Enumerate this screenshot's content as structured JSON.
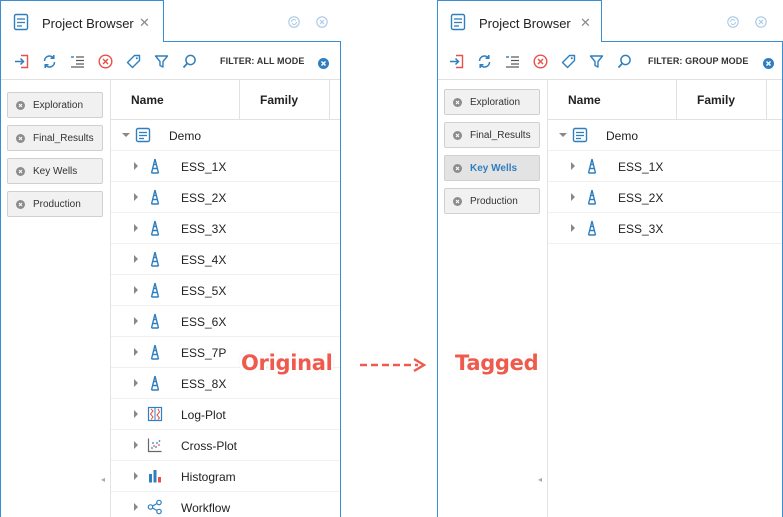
{
  "left_panel": {
    "tab_title": "Project Browser",
    "filter_label": "FILTER: ALL MODE",
    "tags": [
      {
        "label": "Exploration",
        "active": false
      },
      {
        "label": "Final_Results",
        "active": false
      },
      {
        "label": "Key Wells",
        "active": false
      },
      {
        "label": "Production",
        "active": false
      }
    ],
    "columns": {
      "name": "Name",
      "family": "Family"
    },
    "tree": [
      {
        "label": "Demo",
        "icon": "document-icon",
        "expanded": true,
        "level": 0
      },
      {
        "label": "ESS_1X",
        "icon": "well-derrick-icon",
        "level": 1
      },
      {
        "label": "ESS_2X",
        "icon": "well-derrick-icon",
        "level": 1
      },
      {
        "label": "ESS_3X",
        "icon": "well-derrick-icon",
        "level": 1
      },
      {
        "label": "ESS_4X",
        "icon": "well-derrick-icon",
        "level": 1
      },
      {
        "label": "ESS_5X",
        "icon": "well-derrick-icon",
        "level": 1
      },
      {
        "label": "ESS_6X",
        "icon": "well-derrick-icon",
        "level": 1
      },
      {
        "label": "ESS_7P",
        "icon": "well-derrick-icon",
        "level": 1
      },
      {
        "label": "ESS_8X",
        "icon": "well-derrick-icon",
        "level": 1
      },
      {
        "label": "Log-Plot",
        "icon": "log-plot-icon",
        "level": 1
      },
      {
        "label": "Cross-Plot",
        "icon": "cross-plot-icon",
        "level": 1
      },
      {
        "label": "Histogram",
        "icon": "histogram-icon",
        "level": 1
      },
      {
        "label": "Workflow",
        "icon": "workflow-icon",
        "level": 1
      }
    ]
  },
  "right_panel": {
    "tab_title": "Project Browser",
    "filter_label": "FILTER: GROUP MODE",
    "tags": [
      {
        "label": "Exploration",
        "active": false
      },
      {
        "label": "Final_Results",
        "active": false
      },
      {
        "label": "Key Wells",
        "active": true
      },
      {
        "label": "Production",
        "active": false
      }
    ],
    "columns": {
      "name": "Name",
      "family": "Family"
    },
    "tree": [
      {
        "label": "Demo",
        "icon": "document-icon",
        "expanded": true,
        "level": 0
      },
      {
        "label": "ESS_1X",
        "icon": "well-derrick-icon",
        "level": 1
      },
      {
        "label": "ESS_2X",
        "icon": "well-derrick-icon",
        "level": 1
      },
      {
        "label": "ESS_3X",
        "icon": "well-derrick-icon",
        "level": 1
      }
    ]
  },
  "annotations": {
    "original_label": "Original",
    "tagged_label": "Tagged"
  },
  "colors": {
    "accent_blue": "#3a8fd4",
    "annotation_red": "#ef5a4c",
    "active_tag_text": "#2f7fbf",
    "icon_red": "#e8504a",
    "icon_blue": "#2f7fbf"
  }
}
